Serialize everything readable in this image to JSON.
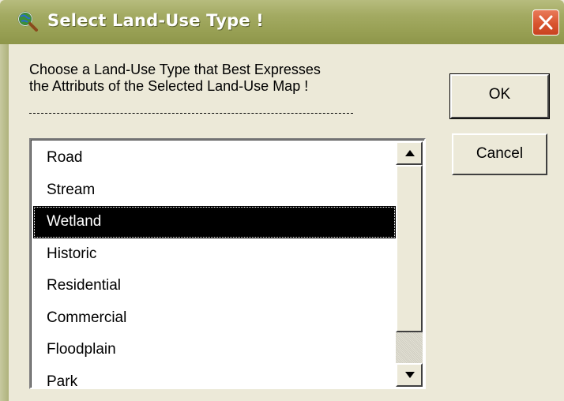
{
  "window": {
    "title": "Select Land-Use Type !",
    "app_icon": "globe-magnifier-icon",
    "close_icon": "close-icon"
  },
  "prompt": {
    "line1": "Choose a Land-Use Type that Best Expresses",
    "line2": "the Attributs of the Selected Land-Use Map !"
  },
  "list": {
    "items": [
      {
        "label": "Road"
      },
      {
        "label": "Stream"
      },
      {
        "label": "Wetland",
        "selected": true
      },
      {
        "label": "Historic"
      },
      {
        "label": "Residential"
      },
      {
        "label": "Commercial"
      },
      {
        "label": "Floodplain"
      },
      {
        "label": "Park"
      }
    ],
    "selected_value": "Wetland"
  },
  "buttons": {
    "ok_label": "OK",
    "cancel_label": "Cancel"
  },
  "colors": {
    "titlebar": "#a3aa62",
    "close_button": "#d9542f",
    "selection": "#000000",
    "dialog_bg": "#ece9d8"
  }
}
